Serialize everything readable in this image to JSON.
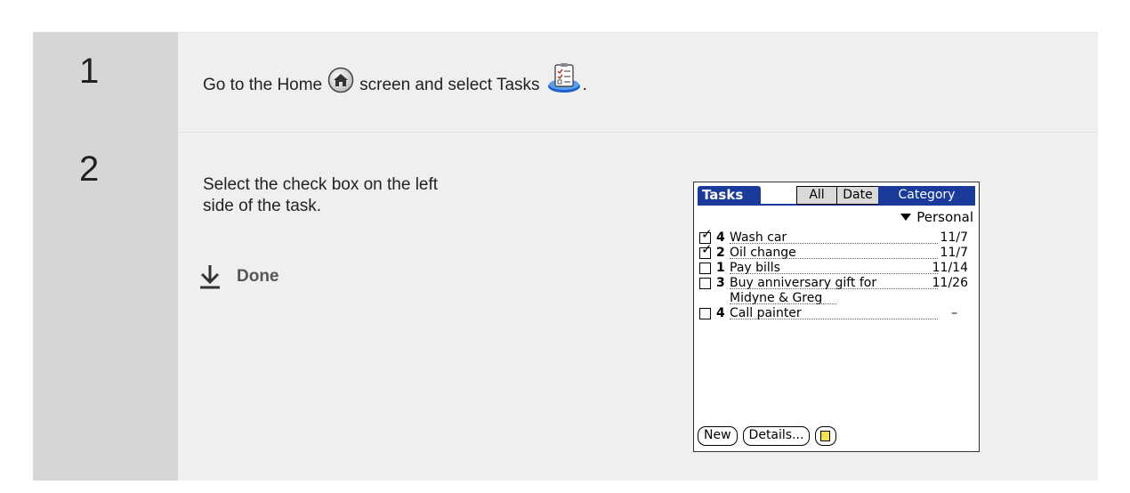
{
  "steps": [
    {
      "number": "1",
      "text_before_home": "Go to the Home",
      "text_middle": "screen and select Tasks",
      "text_after": "."
    },
    {
      "number": "2",
      "instruction": "Select the check box on the left side of the task.",
      "done_label": "Done"
    }
  ],
  "palm": {
    "title": "Tasks",
    "tabs": [
      "All",
      "Date",
      "Category"
    ],
    "category": "Personal",
    "tasks": [
      {
        "checked": true,
        "priority": "4",
        "description": "Wash car",
        "due": "11/7"
      },
      {
        "checked": true,
        "priority": "2",
        "description": "Oil change",
        "due": "11/7"
      },
      {
        "checked": false,
        "priority": "1",
        "description": "Pay bills",
        "due": "11/14"
      },
      {
        "checked": false,
        "priority": "3",
        "description": "Buy anniversary gift for",
        "due": "11/26"
      },
      {
        "checked": false,
        "priority": "",
        "description": "Midyne & Greg",
        "due": ""
      },
      {
        "checked": false,
        "priority": "4",
        "description": "Call painter",
        "due": "–"
      }
    ],
    "buttons": [
      "New",
      "Details..."
    ],
    "checkmark": "✓"
  },
  "icons": {
    "home": "home-icon",
    "tasks": "tasks-icon",
    "done_arrow": "down-arrow-icon",
    "note": "note-icon"
  },
  "colors": {
    "palm_blue": "#1a3b9c",
    "num_bg": "#d6d6d6",
    "content_bg": "#efefef"
  }
}
